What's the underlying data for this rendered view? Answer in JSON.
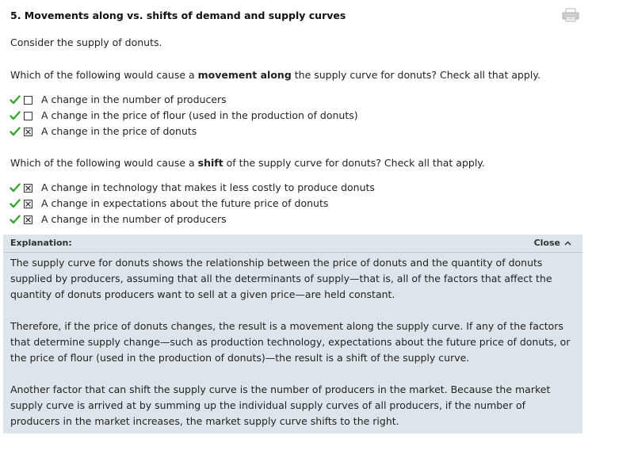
{
  "title": "5. Movements along vs. shifts of demand and supply curves",
  "intro": "Consider the supply of donuts.",
  "question1": {
    "prefix": "Which of the following would cause a ",
    "emphasis": "movement along",
    "suffix": " the supply curve for donuts? Check all that apply.",
    "options": [
      {
        "label": "A change in the number of producers",
        "checked": false,
        "correct": true
      },
      {
        "label": "A change in the price of flour (used in the production of donuts)",
        "checked": false,
        "correct": true
      },
      {
        "label": "A change in the price of donuts",
        "checked": true,
        "correct": true
      }
    ]
  },
  "question2": {
    "prefix": "Which of the following would cause a ",
    "emphasis": "shift",
    "suffix": " of the supply curve for donuts? Check all that apply.",
    "options": [
      {
        "label": "A change in technology that makes it less costly to produce donuts",
        "checked": true,
        "correct": true
      },
      {
        "label": "A change in expectations about the future price of donuts",
        "checked": true,
        "correct": true
      },
      {
        "label": "A change in the number of producers",
        "checked": true,
        "correct": true
      }
    ]
  },
  "explanation": {
    "label": "Explanation:",
    "close_label": "Close",
    "paragraphs": [
      "The supply curve for donuts shows the relationship between the price of donuts and the quantity of donuts supplied by producers, assuming that all the determinants of supply—that is, all of the factors that affect the quantity of donuts producers want to sell at a given price—are held constant.",
      "Therefore, if the price of donuts changes, the result is a movement along the supply curve. If any of the factors that determine supply change—such as production technology, expectations about the future price of donuts, or the price of flour (used in the production of donuts)—the result is a shift of the supply curve.",
      "Another factor that can shift the supply curve is the number of producers in the market. Because the market supply curve is arrived at by summing up the individual supply curves of all producers, if the number of producers in the market increases, the market supply curve shifts to the right."
    ]
  },
  "colors": {
    "check": "#3aa535",
    "explanation_bg": "#dce6ea"
  },
  "icons": {
    "print": "print-icon",
    "correct": "check-mark-icon",
    "close": "chevron-up-icon"
  }
}
